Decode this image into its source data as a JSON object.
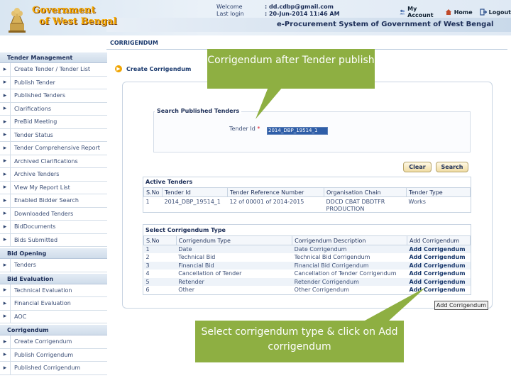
{
  "header": {
    "logo_line1": "Government",
    "logo_line2": "of West Bengal",
    "welcome_label": "Welcome",
    "welcome_value": ": dd.cdbp@gmail.com",
    "last_login_label": "Last login",
    "last_login_value": ": 20-Jun-2014 11:46 AM",
    "my_account": "My Account",
    "home": "Home",
    "logout": "Logout",
    "system_title": "e-Procurement System of Government of West Bengal"
  },
  "page_title": "CORRIGENDUM",
  "sidebar": {
    "sections": [
      {
        "title": "Tender Management",
        "items": [
          "Create Tender / Tender List",
          "Publish Tender",
          "Published Tenders",
          "Clarifications",
          "PreBid Meeting",
          "Tender Status",
          "Tender Comprehensive Report",
          "Archived Clarifications",
          "Archive Tenders",
          "View My Report List",
          "Enabled Bidder Search",
          "Downloaded Tenders",
          "BidDocuments",
          "Bids Submitted"
        ]
      },
      {
        "title": "Bid Opening",
        "items": [
          "Tenders"
        ]
      },
      {
        "title": "Bid Evaluation",
        "items": [
          "Technical Evaluation",
          "Financial Evaluation",
          "AOC"
        ]
      },
      {
        "title": "Corrigendum",
        "items": [
          "Create Corrigendum",
          "Publish Corrigendum",
          "Published Corrigendum"
        ]
      }
    ]
  },
  "main": {
    "create_link": "Create Corrigendum",
    "search": {
      "legend": "Search Published Tenders",
      "tender_id_label": "Tender Id",
      "required_mark": "*",
      "tender_id_value": "2014_DBP_19514_1",
      "clear_button": "Clear",
      "search_button": "Search"
    },
    "active_tenders": {
      "title": "Active Tenders",
      "headers": [
        "S.No",
        "Tender Id",
        "Tender Reference Number",
        "Organisation Chain",
        "Tender Type"
      ],
      "rows": [
        [
          "1",
          "2014_DBP_19514_1",
          "12 of 00001 of 2014-2015",
          "DDCD CBAT DBDTFR PRODUCTION",
          "Works"
        ]
      ]
    },
    "corrigendum_type": {
      "title": "Select Corrigendum Type",
      "headers": [
        "S.No",
        "Corrigendum Type",
        "Corrigendum Description",
        "Add Corrigendum"
      ],
      "rows": [
        [
          "1",
          "Date",
          "Date Corrigendum",
          "Add Corrigendum"
        ],
        [
          "2",
          "Technical Bid",
          "Technical Bid Corrigendum",
          "Add Corrigendum"
        ],
        [
          "3",
          "Financial Bid",
          "Financial Bid Corrigendum",
          "Add Corrigendum"
        ],
        [
          "4",
          "Cancellation of Tender",
          "Cancellation of Tender Corrigendum",
          "Add Corrigendum"
        ],
        [
          "5",
          "Retender",
          "Retender Corrigendum",
          "Add Corrigendum"
        ],
        [
          "6",
          "Other",
          "Other Corrigendum",
          "Add Corrigendum"
        ]
      ]
    },
    "add_corrigendum_button": "Add Corrigendum"
  },
  "callouts": {
    "top": "Corrigendum after Tender publish",
    "bottom": "Select corrigendum type & click on Add corrigendum"
  },
  "colors": {
    "callout_green": "#8eaf42",
    "logo_orange": "#f5a800",
    "input_highlight": "#2f5ea8"
  }
}
